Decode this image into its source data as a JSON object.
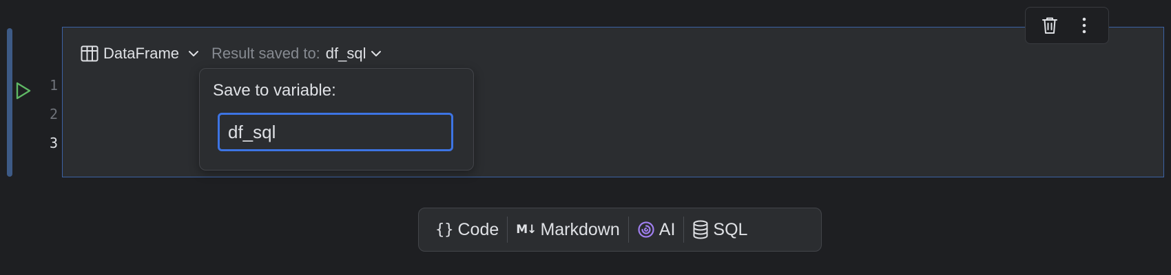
{
  "cell": {
    "line_numbers": [
      "1",
      "2",
      "3"
    ],
    "active_line_index": 2
  },
  "sql_header": {
    "output_type_label": "DataFrame",
    "output_type_icon": "table-icon",
    "result_saved_label": "Result saved to:",
    "result_variable": "df_sql"
  },
  "popup": {
    "title": "Save to variable:",
    "input_value": "df_sql"
  },
  "cell_toolbar": {
    "delete_icon": "trash-icon",
    "more_icon": "more-vertical-icon"
  },
  "add_cell_bar": {
    "items": [
      {
        "label": "Code",
        "icon": "braces-icon"
      },
      {
        "label": "Markdown",
        "icon": "markdown-icon"
      },
      {
        "label": "AI",
        "icon": "ai-swirl-icon"
      },
      {
        "label": "SQL",
        "icon": "database-icon"
      }
    ]
  },
  "colors": {
    "background": "#1e1f22",
    "cell_background": "#2b2d30",
    "cell_border": "#3c63a6",
    "input_focus": "#3d74e3",
    "run_green": "#5fb865",
    "ai_purple": "#a07ff0"
  }
}
